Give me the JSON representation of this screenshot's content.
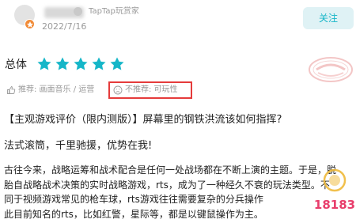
{
  "header": {
    "author_tag": "TapTap玩赏家",
    "date": "2022/7/16",
    "follow_label": "关注"
  },
  "rating": {
    "label": "总体",
    "stars": 5,
    "max_stars": 5,
    "star_color": "#15b6c8"
  },
  "tags": {
    "recommend": "推荐: 画面音乐 / 运营",
    "not_recommend": "不推荐: 可玩性",
    "highlight_color": "#e53b3b"
  },
  "review": {
    "title": "【主观游戏评价（限内测版）】屏幕里的钢铁洪流该如何指挥?",
    "tagline": "法式滚筒，千里驰援，优势在我!",
    "paragraph_lines": [
      "古往今来，战略运筹和战术配合是任何一处战场都在不断上演的主题。于是，脱",
      "胎自战略战术决策的实时战略游戏，rts，成为了一种经久不衰的玩法类型。不",
      "同于视频游戏常见的枪车球，rts游戏往往需要复杂的分兵操作",
      "此目前知名的rts，比如红警，星际等，都是以键鼠操作为主。"
    ]
  },
  "watermark": {
    "text": "18183"
  }
}
